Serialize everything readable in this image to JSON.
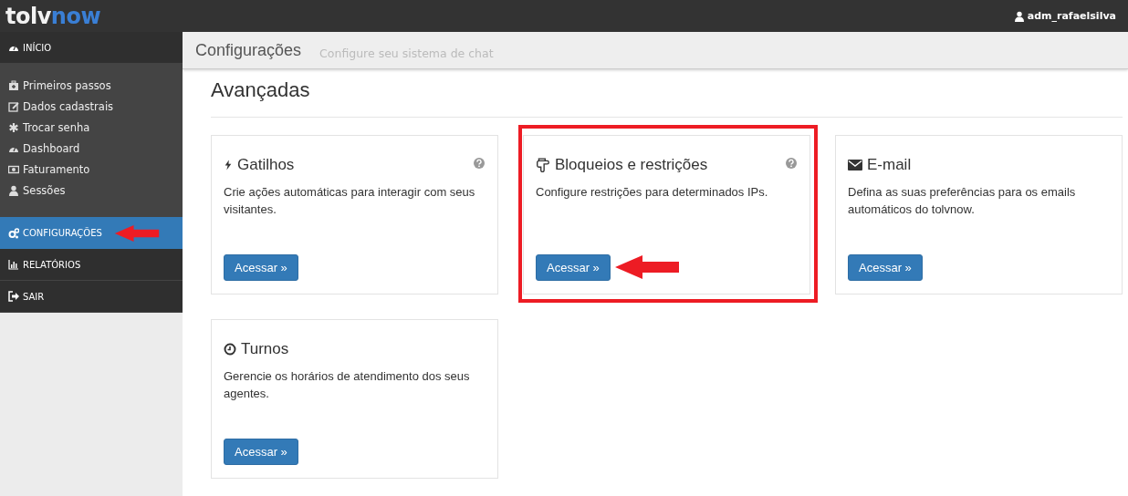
{
  "brand": {
    "part_1": "tolv",
    "part_2": "now"
  },
  "user": {
    "name": "adm_rafaelsilva"
  },
  "nav": [
    {
      "label": "INÍCIO",
      "kind": "dashboard",
      "selected": false,
      "arrow": false,
      "children": [
        {
          "label": "Primeiros passos",
          "kind": "kit"
        },
        {
          "label": "Dados cadastrais",
          "kind": "edit"
        },
        {
          "label": "Trocar senha",
          "kind": "asterisk"
        },
        {
          "label": "Dashboard",
          "kind": "dashboard"
        },
        {
          "label": "Faturamento",
          "kind": "money"
        },
        {
          "label": "Sessões",
          "kind": "user"
        }
      ]
    },
    {
      "label": "CONFIGURAÇÕES",
      "kind": "cogs",
      "selected": true,
      "arrow": true
    },
    {
      "label": "RELATÓRIOS",
      "kind": "chart",
      "selected": false,
      "arrow": false
    },
    {
      "label": "SAIR",
      "kind": "exit",
      "selected": false,
      "arrow": false
    }
  ],
  "header": {
    "title": "Configurações",
    "subtitle": "Configure seu sistema de chat"
  },
  "section_title": "Avançadas",
  "cards": [
    {
      "kind": "bolt",
      "title": "Gatilhos",
      "description": "Crie ações automáticas para interagir com seus visitantes.",
      "help": true,
      "highlighted": false,
      "button": "Acessar »"
    },
    {
      "kind": "hand",
      "title": "Bloqueios e restrições",
      "description": "Configure restrições para determinados IPs.",
      "help": true,
      "highlighted": true,
      "button": "Acessar »"
    },
    {
      "kind": "envelope",
      "title": "E-mail",
      "description": "Defina as suas preferências para os emails automáticos do tolvnow.",
      "help": false,
      "highlighted": false,
      "button": "Acessar »"
    },
    {
      "kind": "clock",
      "title": "Turnos",
      "description": "Gerencie os horários de atendimento dos seus agentes.",
      "help": false,
      "highlighted": false,
      "button": "Acessar »"
    }
  ]
}
